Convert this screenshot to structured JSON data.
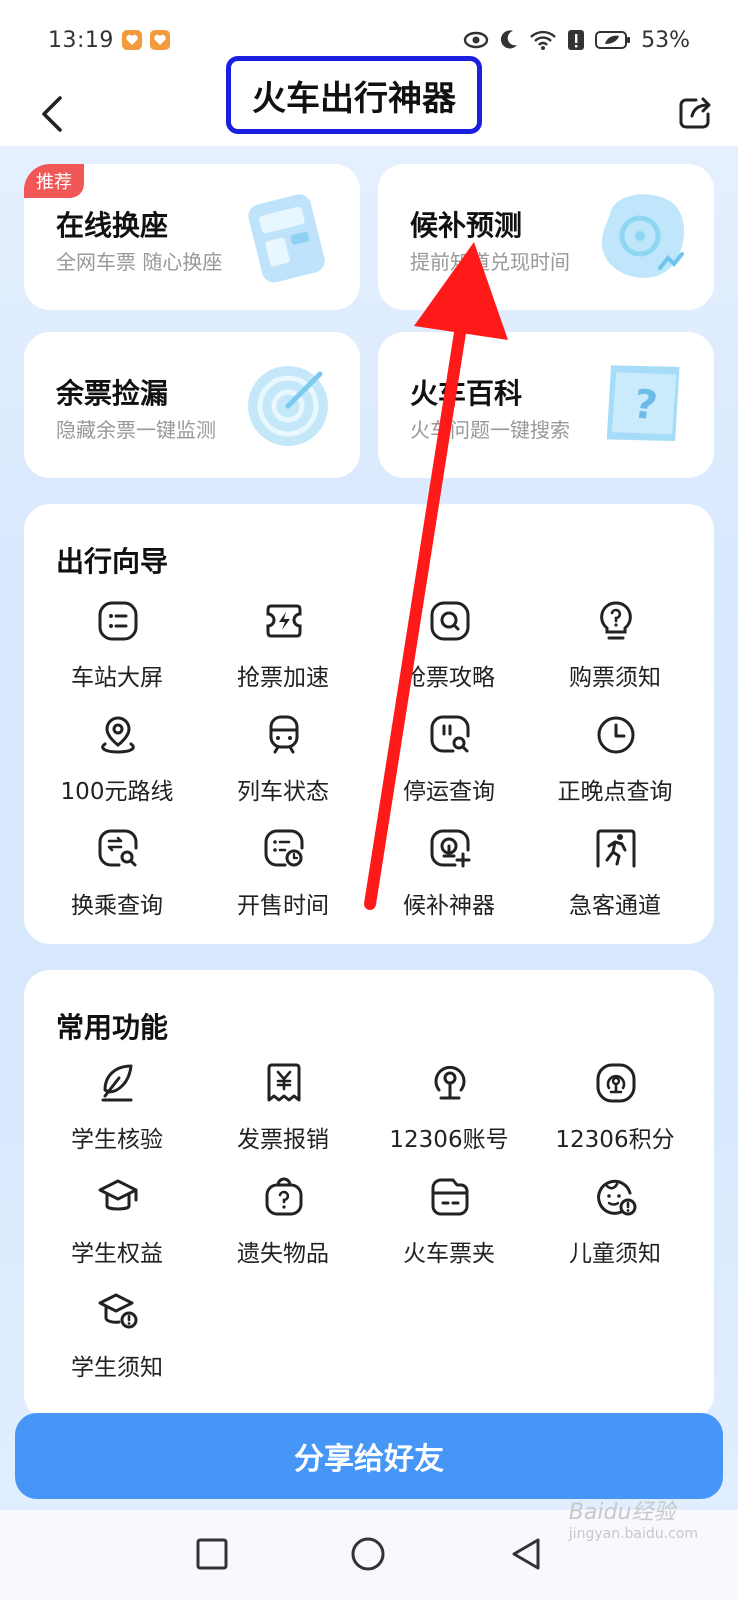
{
  "status_bar": {
    "time": "13:19",
    "battery": "53%",
    "icons": [
      "heart-app-icon",
      "heart-app-icon",
      "eye-icon",
      "moon-icon",
      "wifi-icon",
      "alert-icon",
      "battery-icon"
    ]
  },
  "header": {
    "title": "火车出行神器",
    "back_icon": "chevron-left-icon",
    "share_icon": "share-icon"
  },
  "feature_cards": [
    {
      "title": "在线换座",
      "subtitle": "全网车票 随心换座",
      "badge": "推荐",
      "art": "ticket-art"
    },
    {
      "title": "候补预测",
      "subtitle": "提前知道兑现时间",
      "art": "clock-blob-art"
    },
    {
      "title": "余票捡漏",
      "subtitle": "隐藏余票一键监测",
      "art": "radar-art"
    },
    {
      "title": "火车百科",
      "subtitle": "火车问题一键搜索",
      "art": "question-book-art"
    }
  ],
  "travel_guide": {
    "title": "出行向导",
    "items": [
      {
        "label": "车站大屏",
        "icon": "screen-list-icon"
      },
      {
        "label": "抢票加速",
        "icon": "lightning-icon"
      },
      {
        "label": "抢票攻略",
        "icon": "search-square-icon"
      },
      {
        "label": "购票须知",
        "icon": "question-bulb-icon"
      },
      {
        "label": "100元路线",
        "icon": "location-pin-icon"
      },
      {
        "label": "列车状态",
        "icon": "train-icon"
      },
      {
        "label": "停运查询",
        "icon": "pause-search-icon"
      },
      {
        "label": "正晚点查询",
        "icon": "clock-icon"
      },
      {
        "label": "换乘查询",
        "icon": "transfer-search-icon"
      },
      {
        "label": "开售时间",
        "icon": "sale-time-icon"
      },
      {
        "label": "候补神器",
        "icon": "waitlist-icon"
      },
      {
        "label": "急客通道",
        "icon": "running-person-icon"
      }
    ]
  },
  "common_functions": {
    "title": "常用功能",
    "items": [
      {
        "label": "学生核验",
        "icon": "quill-icon"
      },
      {
        "label": "发票报销",
        "icon": "yuan-receipt-icon"
      },
      {
        "label": "12306账号",
        "icon": "rail-logo-icon"
      },
      {
        "label": "12306积分",
        "icon": "rail-points-icon"
      },
      {
        "label": "学生权益",
        "icon": "graduation-cap-icon"
      },
      {
        "label": "遗失物品",
        "icon": "lost-bag-icon"
      },
      {
        "label": "火车票夹",
        "icon": "ticket-wallet-icon"
      },
      {
        "label": "儿童须知",
        "icon": "child-notice-icon"
      },
      {
        "label": "学生须知",
        "icon": "student-notice-icon"
      }
    ]
  },
  "share_button": {
    "label": "分享给好友"
  },
  "system_nav": {
    "icons": [
      "recent-apps-icon",
      "home-icon",
      "back-triangle-icon"
    ]
  },
  "watermark": {
    "text": "Baidu经验",
    "sub": "jingyan.baidu.com"
  },
  "colors": {
    "accent": "#4596f6",
    "badge": "#f25757",
    "highlight_box": "#1a1fe0",
    "arrow": "#ff1a1a"
  }
}
